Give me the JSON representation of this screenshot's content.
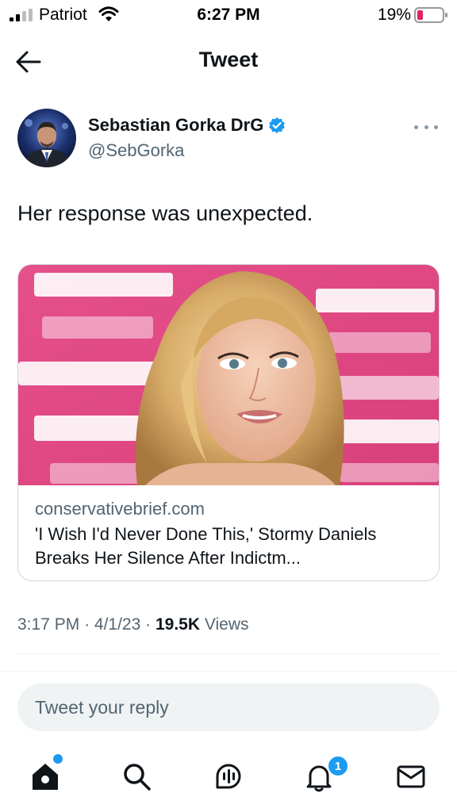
{
  "status_bar": {
    "carrier": "Patriot",
    "time": "6:27 PM",
    "battery": "19%"
  },
  "header": {
    "title": "Tweet",
    "back_icon": "arrow-left-icon"
  },
  "tweet": {
    "author_name": "Sebastian Gorka DrG",
    "author_handle": "@SebGorka",
    "verified": true,
    "text": "Her response was unexpected.",
    "card": {
      "domain": "conservativebrief.com",
      "title": "'I Wish I'd Never Done This,' Stormy Daniels Breaks Her Silence After Indictm..."
    },
    "time": "3:17 PM",
    "sep1": "·",
    "date": "4/1/23",
    "sep2": "·",
    "views_count": "19.5K",
    "views_label": "Views"
  },
  "reply": {
    "placeholder": "Tweet your reply"
  },
  "tab_bar": {
    "notifications_badge": "1",
    "icons": [
      "home-icon",
      "search-icon",
      "spaces-icon",
      "notifications-icon",
      "messages-icon"
    ]
  },
  "colors": {
    "accent": "#1d9bf0",
    "battery_low": "#e0245e",
    "muted_text": "#536471"
  }
}
